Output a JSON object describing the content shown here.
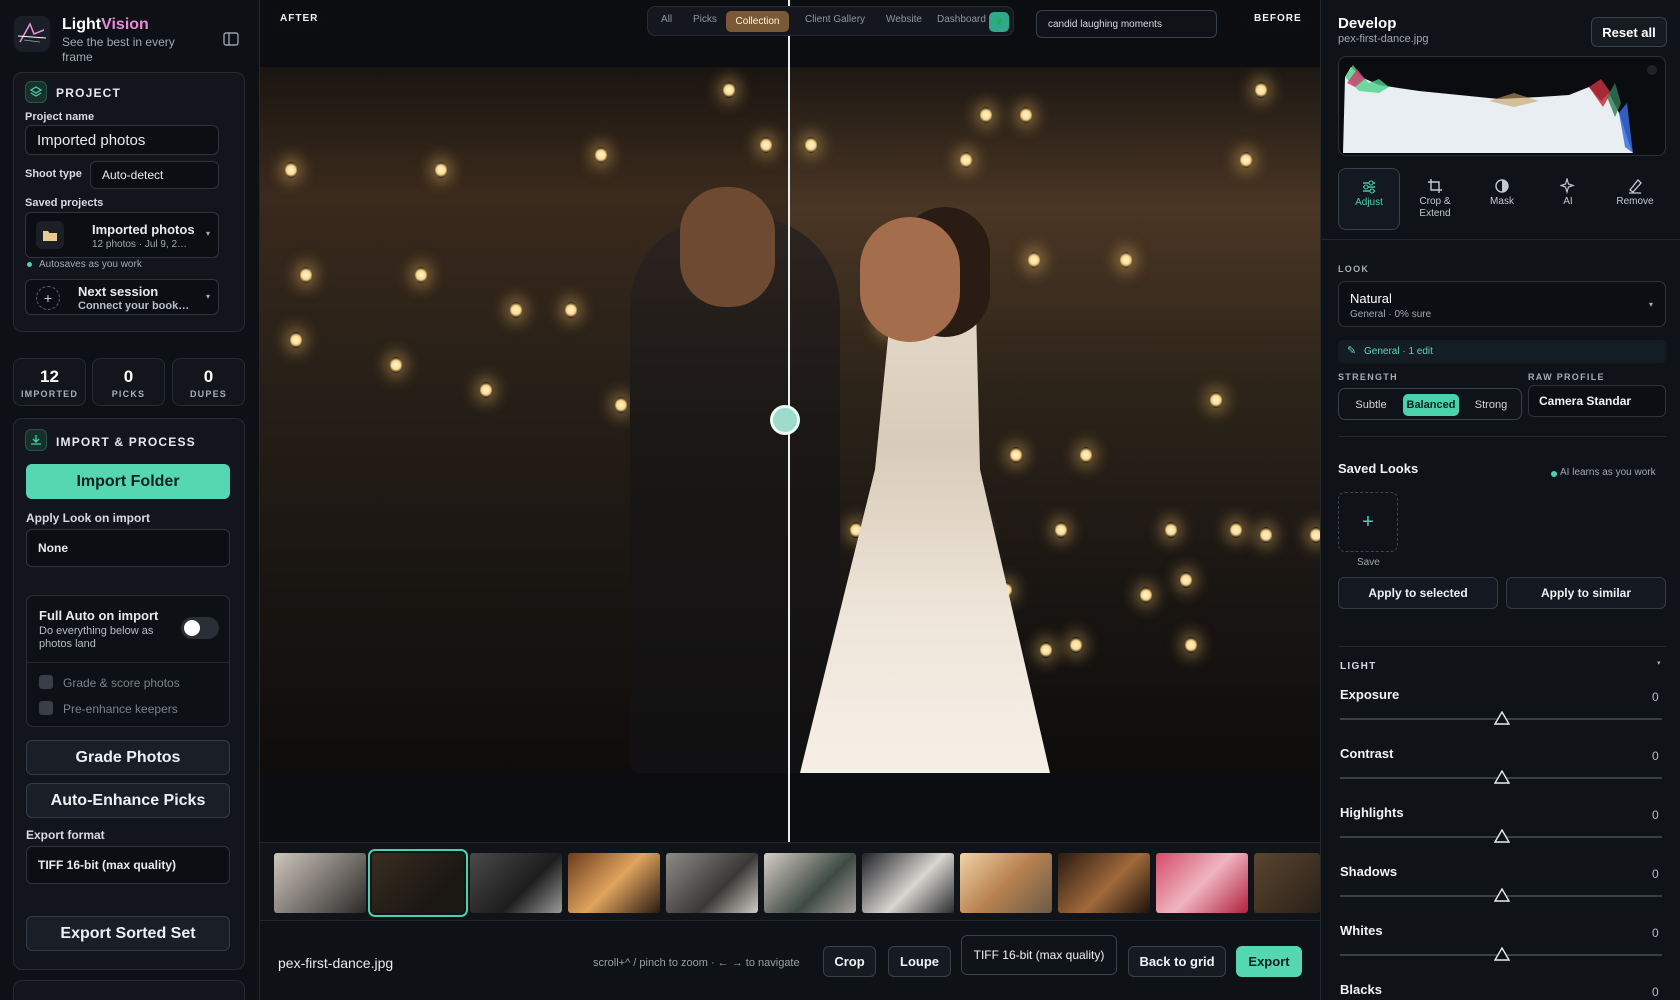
{
  "app": {
    "name_part1": "Light",
    "name_part2": "Vision",
    "tagline": "See the best in every frame"
  },
  "project": {
    "section_title": "PROJECT",
    "name_label": "Project name",
    "name_value": "Imported photos",
    "shoot_type_label": "Shoot type",
    "shoot_type_value": "Auto-detect",
    "saved_label": "Saved projects",
    "saved_item_title": "Imported photos",
    "saved_item_meta": "12 photos · Jul 9, 2…",
    "autosave": "Autosaves as you work",
    "next_title": "Next session",
    "next_sub": "Connect your book…"
  },
  "stats": [
    {
      "value": "12",
      "label": "IMPORTED"
    },
    {
      "value": "0",
      "label": "PICKS"
    },
    {
      "value": "0",
      "label": "DUPES"
    }
  ],
  "import": {
    "section_title": "IMPORT & PROCESS",
    "import_button": "Import Folder",
    "apply_look_label": "Apply Look on import",
    "apply_look_value": "None",
    "full_auto_title": "Full Auto on import",
    "full_auto_sub": "Do everything below as photos land",
    "check_grade": "Grade & score photos",
    "check_enhance": "Pre-enhance keepers",
    "grade_button": "Grade Photos",
    "enhance_button": "Auto-Enhance Picks",
    "export_format_label": "Export format",
    "export_format_value": "TIFF 16-bit (max quality)",
    "export_button": "Export Sorted Set"
  },
  "viewer": {
    "after_tag": "AFTER",
    "before_tag": "BEFORE",
    "nav": [
      "All",
      "Picks",
      "Collection",
      "Client Gallery",
      "Website",
      "Dashboard"
    ],
    "nav_active": "Collection",
    "nav_badge": "#",
    "search_value": "candid laughing moments",
    "split_position": 0.5
  },
  "bottombar": {
    "filename": "pex-first-dance.jpg",
    "hint": "scroll+^ / pinch to zoom · ← → to navigate",
    "crop": "Crop",
    "loupe": "Loupe",
    "format": "TIFF 16-bit (max quality)",
    "back": "Back to grid",
    "export": "Export"
  },
  "develop": {
    "title": "Develop",
    "file": "pex-first-dance.jpg",
    "reset": "Reset all",
    "tools": [
      {
        "label": "Adjust",
        "icon": "sliders-icon"
      },
      {
        "label": "Crop & Extend",
        "icon": "crop-icon"
      },
      {
        "label": "Mask",
        "icon": "mask-icon"
      },
      {
        "label": "AI",
        "icon": "sparkle-icon"
      },
      {
        "label": "Remove",
        "icon": "eraser-icon"
      }
    ],
    "look_caption": "LOOK",
    "look_name": "Natural",
    "look_sub": "General · 0% sure",
    "chip": "General · 1 edit",
    "strength_caption": "STRENGTH",
    "strength_options": [
      "Subtle",
      "Balanced",
      "Strong"
    ],
    "strength_active": "Balanced",
    "raw_caption": "RAW PROFILE",
    "raw_value": "Camera Standar",
    "saved_looks_title": "Saved Looks",
    "saved_looks_note": "AI learns as you work",
    "save_label": "Save",
    "apply_selected": "Apply to selected",
    "apply_similar": "Apply to similar",
    "light_caption": "LIGHT",
    "sliders": [
      {
        "label": "Exposure",
        "value": "0"
      },
      {
        "label": "Contrast",
        "value": "0"
      },
      {
        "label": "Highlights",
        "value": "0"
      },
      {
        "label": "Shadows",
        "value": "0"
      },
      {
        "label": "Whites",
        "value": "0"
      },
      {
        "label": "Blacks",
        "value": "0"
      }
    ]
  },
  "colors": {
    "accent": "#4cd1ad",
    "brand_pink": "#e98cd6",
    "nav_active": "#7a5a34"
  }
}
